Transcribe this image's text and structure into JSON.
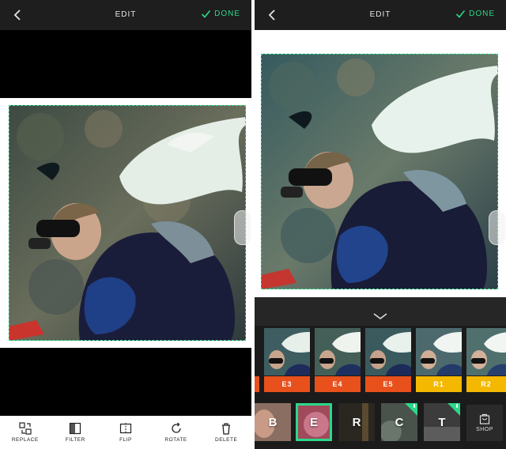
{
  "colors": {
    "accent": "#2bd88a",
    "topbar": "#1e1e1e",
    "e_filter": "#e8501c",
    "r_filter": "#f5b800"
  },
  "left": {
    "header": {
      "title": "EDIT",
      "done_label": "DONE",
      "back_icon": "chevron-left-icon",
      "done_icon": "check-icon"
    },
    "tools": [
      {
        "label": "REPLACE",
        "icon": "replace-icon"
      },
      {
        "label": "FILTER",
        "icon": "filter-icon"
      },
      {
        "label": "FLIP",
        "icon": "flip-icon"
      },
      {
        "label": "ROTATE",
        "icon": "rotate-icon"
      },
      {
        "label": "DELETE",
        "icon": "trash-icon"
      }
    ]
  },
  "right": {
    "header": {
      "title": "EDIT",
      "done_label": "DONE",
      "back_icon": "chevron-left-icon",
      "done_icon": "check-icon"
    },
    "collapse_icon": "chevron-down-icon",
    "filters": [
      {
        "label": "E3",
        "color": "#e8501c"
      },
      {
        "label": "E4",
        "color": "#e8501c"
      },
      {
        "label": "E5",
        "color": "#e8501c"
      },
      {
        "label": "R1",
        "color": "#f5b800"
      },
      {
        "label": "R2",
        "color": "#f5b800"
      }
    ],
    "packs": [
      {
        "label": "B",
        "selected": false,
        "download": false
      },
      {
        "label": "E",
        "selected": true,
        "download": false
      },
      {
        "label": "R",
        "selected": false,
        "download": false
      },
      {
        "label": "C",
        "selected": false,
        "download": true
      },
      {
        "label": "T",
        "selected": false,
        "download": true
      }
    ],
    "shop_label": "SHOP",
    "shop_icon": "shop-icon"
  }
}
